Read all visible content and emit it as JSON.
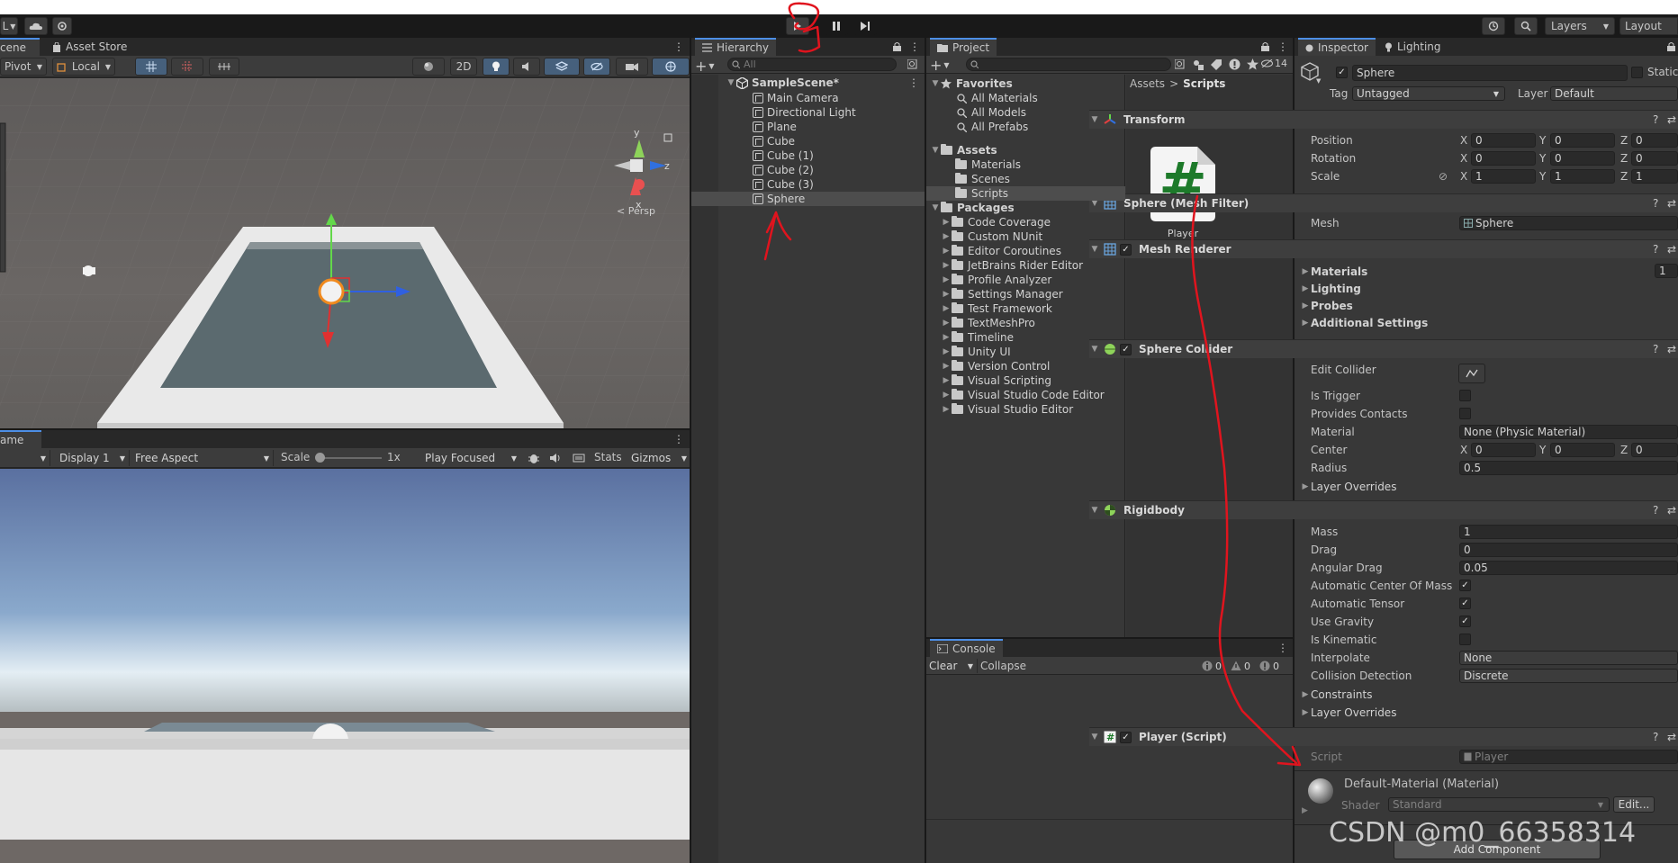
{
  "toolbar": {
    "account_initial": "L",
    "layers_label": "Layers",
    "layout_label": "Layout"
  },
  "scene_panel": {
    "tab_scene": "cene",
    "tab_asset_store": "Asset Store",
    "pivot_label": "Pivot",
    "local_label": "Local",
    "mode_2d": "2D",
    "persp_label": "< Persp",
    "gizmo_axes": {
      "y": "y",
      "x": "x",
      "z": "z"
    }
  },
  "game_panel": {
    "tab_label": "ame",
    "display_label": "Display 1",
    "aspect_label": "Free Aspect",
    "scale_label": "Scale",
    "scale_value": "1x",
    "play_mode_label": "Play Focused",
    "stats_label": "Stats",
    "gizmos_label": "Gizmos"
  },
  "hierarchy": {
    "tab_label": "Hierarchy",
    "search_placeholder": "All",
    "scene_name": "SampleScene*",
    "items": [
      "Main Camera",
      "Directional Light",
      "Plane",
      "Cube",
      "Cube (1)",
      "Cube (2)",
      "Cube (3)",
      "Sphere"
    ],
    "selected_index": 7
  },
  "project": {
    "tab_label": "Project",
    "hidden_count": "14",
    "favorites_label": "Favorites",
    "favorites": [
      "All Materials",
      "All Models",
      "All Prefabs"
    ],
    "assets_label": "Assets",
    "asset_folders": [
      "Materials",
      "Scenes",
      "Scripts"
    ],
    "selected_asset_folder": "Scripts",
    "packages_label": "Packages",
    "packages": [
      "Code Coverage",
      "Custom NUnit",
      "Editor Coroutines",
      "JetBrains Rider Editor",
      "Profile Analyzer",
      "Settings Manager",
      "Test Framework",
      "TextMeshPro",
      "Timeline",
      "Unity UI",
      "Version Control",
      "Visual Scripting",
      "Visual Studio Code Editor",
      "Visual Studio Editor"
    ],
    "breadcrumb": [
      "Assets",
      "Scripts"
    ],
    "breadcrumb_sep": ">",
    "script_asset_name": "Player",
    "script_glyph": "#"
  },
  "console": {
    "tab_label": "Console",
    "clear_label": "Clear",
    "collapse_label": "Collapse",
    "counts": {
      "logs": "0",
      "warnings": "0",
      "errors": "0"
    }
  },
  "inspector": {
    "tab_inspector": "Inspector",
    "tab_lighting": "Lighting",
    "object_name": "Sphere",
    "static_label": "Static",
    "tag_label": "Tag",
    "tag_value": "Untagged",
    "layer_label": "Layer",
    "layer_value": "Default",
    "transform": {
      "title": "Transform",
      "rows": [
        {
          "label": "Position",
          "x": "0",
          "y": "0",
          "z": "0"
        },
        {
          "label": "Rotation",
          "x": "0",
          "y": "0",
          "z": "0"
        },
        {
          "label": "Scale",
          "x": "1",
          "y": "1",
          "z": "1"
        }
      ]
    },
    "axis_labels": {
      "x": "X",
      "y": "Y",
      "z": "Z"
    },
    "mesh_filter": {
      "title": "Sphere (Mesh Filter)",
      "mesh_label": "Mesh",
      "mesh_value": "Sphere"
    },
    "mesh_renderer": {
      "title": "Mesh Renderer",
      "sections": [
        "Materials",
        "Lighting",
        "Probes",
        "Additional Settings"
      ],
      "materials_count": "1"
    },
    "sphere_collider": {
      "title": "Sphere Collider",
      "edit_collider_label": "Edit Collider",
      "is_trigger_label": "Is Trigger",
      "provides_contacts_label": "Provides Contacts",
      "material_label": "Material",
      "material_value": "None (Physic Material)",
      "center_label": "Center",
      "center": {
        "x": "0",
        "y": "0",
        "z": "0"
      },
      "radius_label": "Radius",
      "radius_value": "0.5",
      "layer_overrides_label": "Layer Overrides"
    },
    "rigidbody": {
      "title": "Rigidbody",
      "mass_label": "Mass",
      "mass_value": "1",
      "drag_label": "Drag",
      "drag_value": "0",
      "angular_drag_label": "Angular Drag",
      "angular_drag_value": "0.05",
      "auto_com_label": "Automatic Center Of Mass",
      "auto_tensor_label": "Automatic Tensor",
      "use_gravity_label": "Use Gravity",
      "is_kinematic_label": "Is Kinematic",
      "interpolate_label": "Interpolate",
      "interpolate_value": "None",
      "collision_label": "Collision Detection",
      "collision_value": "Discrete",
      "constraints_label": "Constraints",
      "layer_overrides_label": "Layer Overrides"
    },
    "player_script": {
      "title": "Player (Script)",
      "script_label": "Script",
      "script_value": "Player"
    },
    "material": {
      "name": "Default-Material (Material)",
      "shader_label": "Shader",
      "shader_value": "Standard",
      "edit_label": "Edit..."
    },
    "add_component_label": "Add Component"
  },
  "watermark": "CSDN @m0_66358314",
  "colors": {
    "accent": "#4d8fe6",
    "annotation_red": "#e0141e",
    "selection": "#4d4d4d"
  }
}
